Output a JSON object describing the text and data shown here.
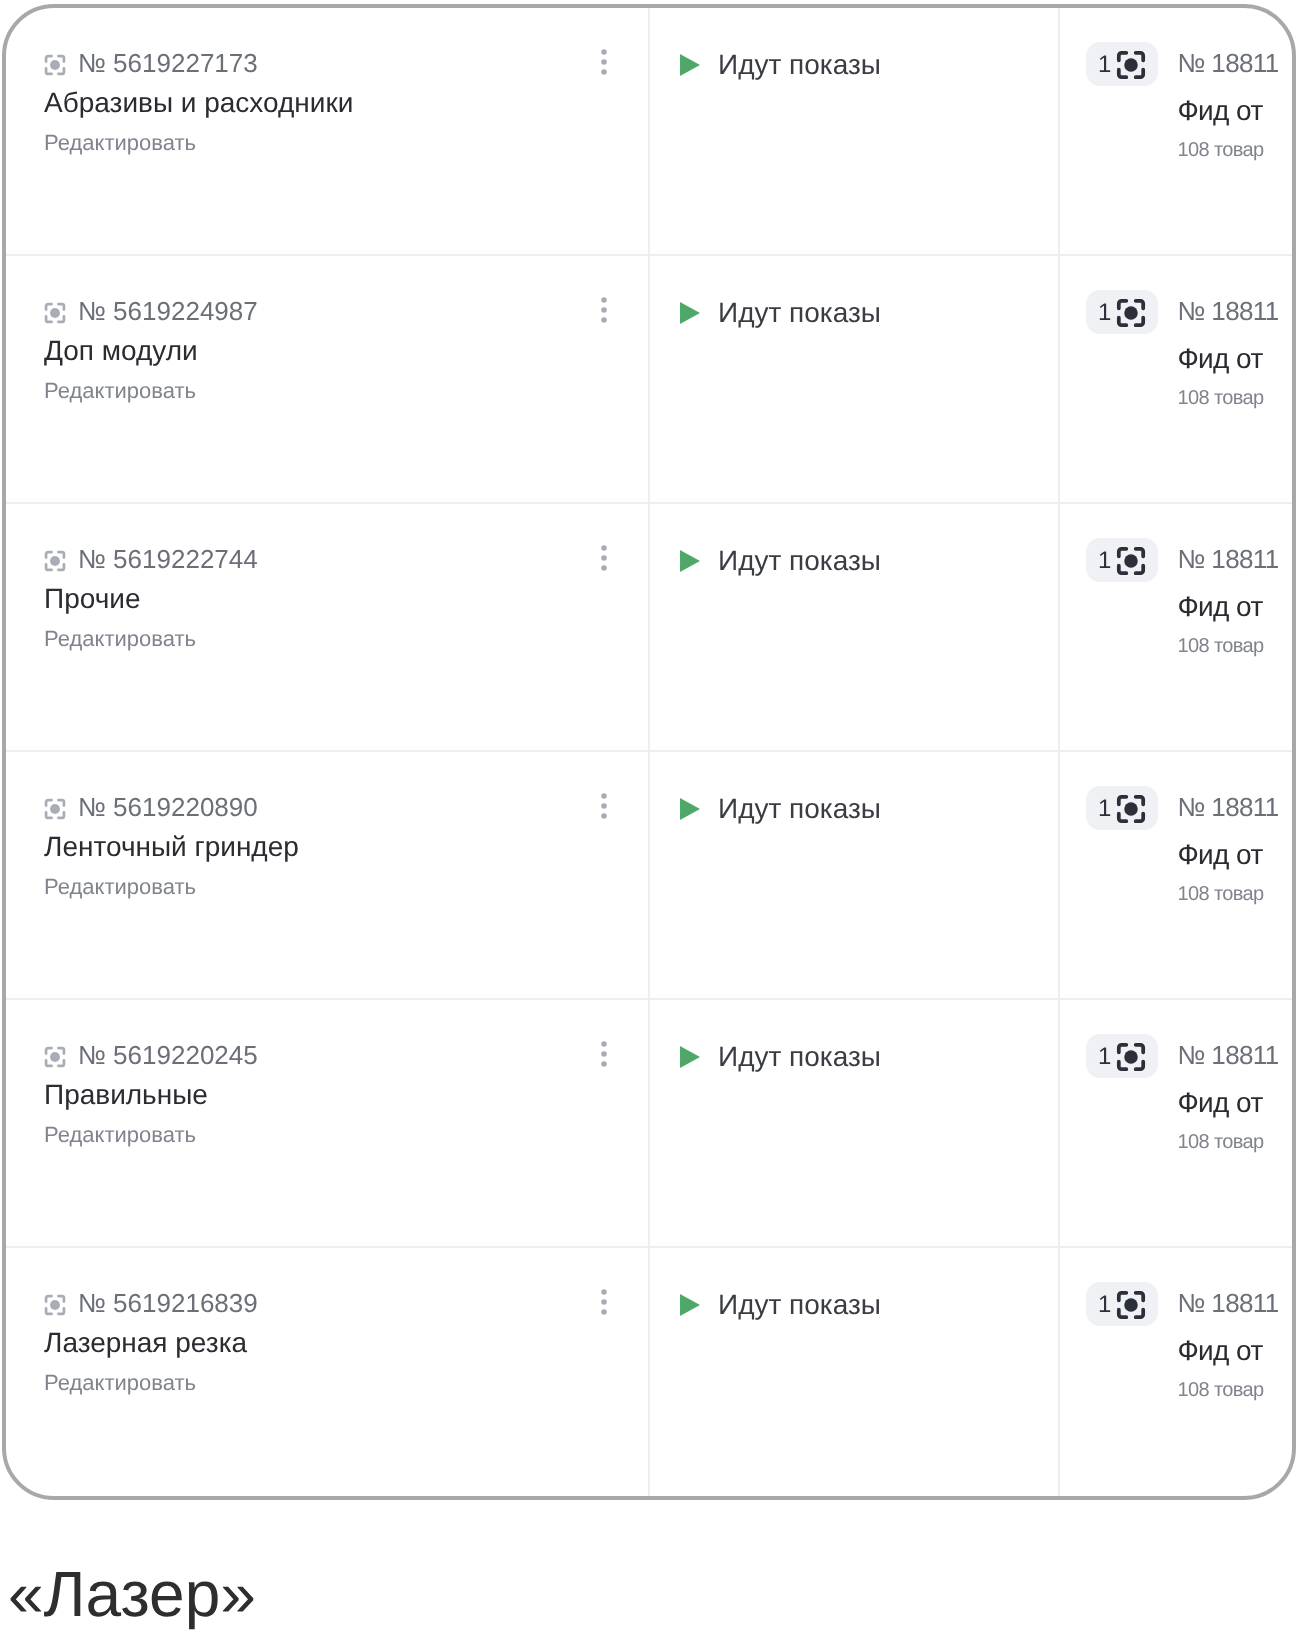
{
  "rows": [
    {
      "number": "№ 5619227173",
      "name": "Абразивы и расходники",
      "edit_link": "Редактировать",
      "status": {
        "kind": "running",
        "label": "Идут показы"
      },
      "feed": {
        "count": "1",
        "number": "№ 18811",
        "name": "Фид от",
        "items": "108 товар"
      }
    },
    {
      "number": "№ 5619224987",
      "name": "Доп модули",
      "edit_link": "Редактировать",
      "status": {
        "kind": "running",
        "label": "Идут показы"
      },
      "feed": {
        "count": "1",
        "number": "№ 18811",
        "name": "Фид от",
        "items": "108 товар"
      }
    },
    {
      "number": "№ 5619222744",
      "name": "Прочие",
      "edit_link": "Редактировать",
      "status": {
        "kind": "running",
        "label": "Идут показы"
      },
      "feed": {
        "count": "1",
        "number": "№ 18811",
        "name": "Фид от",
        "items": "108 товар"
      }
    },
    {
      "number": "№ 5619220890",
      "name": "Ленточный гриндер",
      "edit_link": "Редактировать",
      "status": {
        "kind": "running",
        "label": "Идут показы"
      },
      "feed": {
        "count": "1",
        "number": "№ 18811",
        "name": "Фид от",
        "items": "108 товар"
      }
    },
    {
      "number": "№ 5619220245",
      "name": "Правильные",
      "edit_link": "Редактировать",
      "status": {
        "kind": "running",
        "label": "Идут показы"
      },
      "feed": {
        "count": "1",
        "number": "№ 18811",
        "name": "Фид от",
        "items": "108 товар"
      }
    },
    {
      "number": "№ 5619216839",
      "name": "Лазерная резка",
      "edit_link": "Редактировать",
      "status": {
        "kind": "running",
        "label": "Идут показы"
      },
      "feed": {
        "count": "1",
        "number": "№ 18811",
        "name": "Фид от",
        "items": "108 товар"
      }
    }
  ],
  "caption": "«Лазер»"
}
